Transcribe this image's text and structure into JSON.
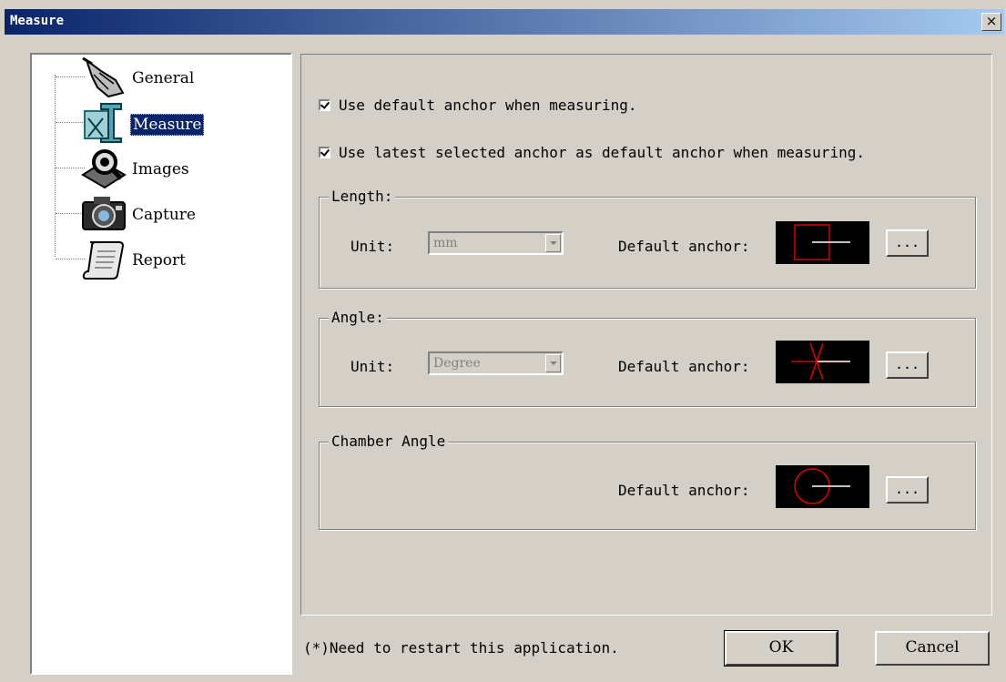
{
  "window": {
    "title": "Measure",
    "close_symbol": "×"
  },
  "tree": {
    "items": [
      {
        "label": "General",
        "icon": "hand-pointer-icon"
      },
      {
        "label": "Measure",
        "icon": "measure-ruler-icon",
        "selected": true
      },
      {
        "label": "Images",
        "icon": "magnifier-photo-icon"
      },
      {
        "label": "Capture",
        "icon": "camera-icon"
      },
      {
        "label": "Report",
        "icon": "scroll-icon"
      }
    ]
  },
  "options": {
    "use_default_anchor": {
      "label": "Use default anchor when measuring.",
      "checked": true
    },
    "use_latest_anchor": {
      "label": "Use latest selected anchor as default anchor when measuring.",
      "checked": true
    }
  },
  "length": {
    "title": "Length:",
    "unit_label": "Unit:",
    "unit_value": "mm",
    "anchor_label": "Default anchor:",
    "browse_label": "..."
  },
  "angle": {
    "title": "Angle:",
    "unit_label": "Unit:",
    "unit_value": "Degree",
    "anchor_label": "Default anchor:",
    "browse_label": "..."
  },
  "chamber_angle": {
    "title": "Chamber Angle",
    "anchor_label": "Default anchor:",
    "browse_label": "..."
  },
  "footer": {
    "note": "(*)Need to restart this application.",
    "ok_label": "OK",
    "cancel_label": "Cancel"
  },
  "colors": {
    "anchor_red": "#e00000",
    "selection": "#0a246a",
    "face": "#d4d0c8"
  }
}
